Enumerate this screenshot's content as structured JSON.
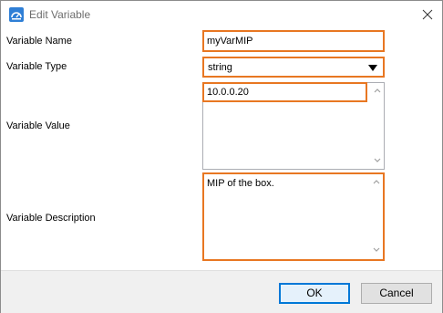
{
  "window": {
    "title": "Edit Variable",
    "app_icon": "dashboard-app-icon",
    "close_icon": "close-icon"
  },
  "form": {
    "name_label": "Variable Name",
    "name_value": "myVarMIP",
    "type_label": "Variable Type",
    "type_value": "string",
    "value_label": "Variable Value",
    "value_value": "10.0.0.20",
    "description_label": "Variable Description",
    "description_value": "MIP of the box."
  },
  "buttons": {
    "ok_label": "OK",
    "cancel_label": "Cancel"
  },
  "colors": {
    "highlight": "#e87722",
    "accent": "#0078d7",
    "footer_bg": "#f0f0f0"
  }
}
